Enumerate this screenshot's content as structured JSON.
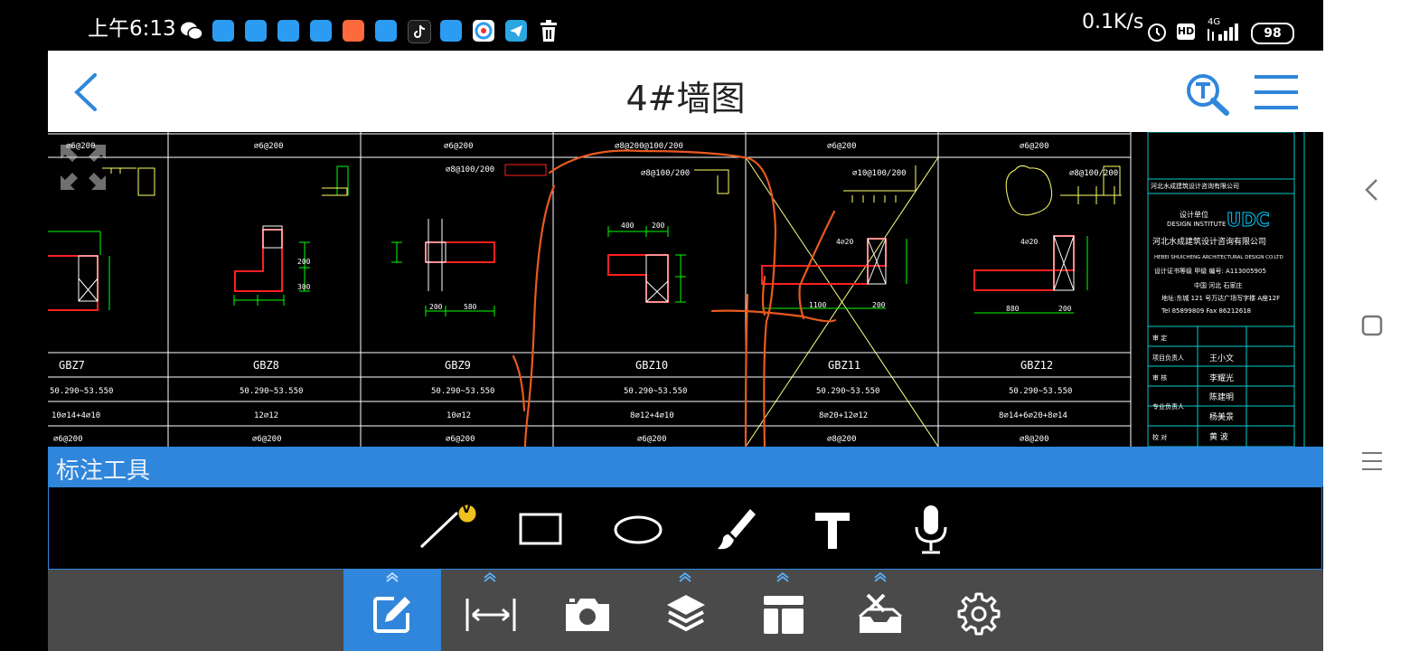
{
  "status_bar": {
    "time": "上午6:13",
    "network_speed": "0.1K/s",
    "hd_label": "HD",
    "signal_label": "4G",
    "battery": "98"
  },
  "header": {
    "title": "4#墙图"
  },
  "drawing": {
    "spacing_labels": [
      "⌀6@200",
      "⌀6@200",
      "⌀6@200",
      "⌀8@200@100/200",
      "⌀6@200",
      "⌀6@200"
    ],
    "columns": [
      {
        "name": "GBZ7",
        "elevation": "50.290~53.550",
        "rebar": "10⌀14+4⌀10",
        "stirrup": "⌀6@200"
      },
      {
        "name": "GBZ8",
        "elevation": "50.290~53.550",
        "rebar": "12⌀12",
        "stirrup": "⌀6@200"
      },
      {
        "name": "GBZ9",
        "elevation": "50.290~53.550",
        "rebar": "10⌀12",
        "stirrup": "⌀6@200"
      },
      {
        "name": "GBZ10",
        "elevation": "50.290~53.550",
        "rebar": "8⌀12+4⌀10",
        "stirrup": "⌀6@200"
      },
      {
        "name": "GBZ11",
        "elevation": "50.290~53.550",
        "rebar": "8⌀20+12⌀12",
        "stirrup": "⌀8@200"
      },
      {
        "name": "GBZ12",
        "elevation": "50.290~53.550",
        "rebar": "8⌀14+6⌀20+8⌀14",
        "stirrup": "⌀8@200"
      }
    ],
    "detail_notes": [
      "⌀8@100/200",
      "⌀8@100/200",
      "⌀10@100/200",
      "⌀8@100/200"
    ],
    "dims": [
      "200",
      "300",
      "200",
      "580",
      "400",
      "200",
      "1100",
      "200",
      "880",
      "200",
      "4⌀20",
      "4⌀20"
    ],
    "title_block": {
      "unit_label": "设计单位",
      "unit_label_en": "DESIGN INSTITUTE",
      "logo": "UDC",
      "company": "河北水成建筑设计咨询有限公司",
      "company_en": "HEBEI SHUICHENG ARCHITECTURAL DESIGN CO.LTD",
      "qualification": "设计证书等级 甲级   编号: A113005905",
      "location": "中国  河北  石家庄",
      "address": "地址:东城 121 号万达广场写字楼 A座12F",
      "phone": "Tel 85899809  Fax 86212618",
      "rows": [
        {
          "role": "审  定",
          "name": ""
        },
        {
          "role": "项目负责人",
          "name": "王小文"
        },
        {
          "role": "审  核",
          "name": "李耀光"
        },
        {
          "role": "专业负责人",
          "name": "陈建明"
        },
        {
          "role": "",
          "name": "杨美景"
        },
        {
          "role": "校  对",
          "name": "黄  波"
        }
      ]
    }
  },
  "annotation_tools": {
    "title": "标注工具",
    "tools": [
      "line-tool",
      "rectangle-tool",
      "ellipse-tool",
      "brush-tool",
      "text-tool",
      "voice-tool"
    ],
    "line_badge": "V"
  },
  "bottom_bar": {
    "items": [
      "annotate",
      "measure",
      "camera",
      "layers",
      "layout",
      "toolbox",
      "settings"
    ],
    "active": "annotate"
  },
  "colors": {
    "accent": "#2f86db",
    "cad_green": "#00ff00",
    "cad_red": "#ff2020",
    "cad_yellow": "#ffff66",
    "cad_cyan": "#00ffff",
    "markup_orange": "#e85a1e",
    "bottom_bar_bg": "#4a4a4a"
  }
}
